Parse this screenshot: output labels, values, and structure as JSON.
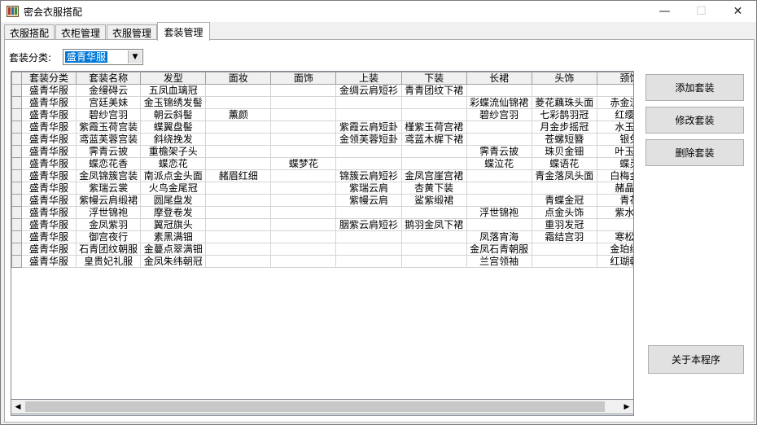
{
  "window": {
    "title": "密会衣服搭配",
    "minimize": "—",
    "maximize": "☐",
    "close": "✕"
  },
  "tabs": [
    "衣服搭配",
    "衣柜管理",
    "衣服管理",
    "套装管理"
  ],
  "active_tab": 3,
  "filter": {
    "label": "套装分类:",
    "value": "盛青华服"
  },
  "buttons": {
    "add": "添加套装",
    "edit": "修改套装",
    "delete": "删除套装",
    "about": "关于本程序"
  },
  "table": {
    "columns": [
      "套装分类",
      "套装名称",
      "发型",
      "面妆",
      "面饰",
      "上装",
      "下装",
      "长裙",
      "头饰",
      "颈饰"
    ],
    "rows": [
      [
        "盛青华服",
        "金缦碍云",
        "五凤血璃冠",
        "",
        "",
        "金绸云肩短衫",
        "青青团纹下裙",
        "",
        "",
        ""
      ],
      [
        "盛青华服",
        "宫廷美妹",
        "金玉锦绣发髻",
        "",
        "",
        "",
        "",
        "彩蝶流仙锦裙",
        "菱花藕珠头面",
        "赤金流苏"
      ],
      [
        "盛青华服",
        "碧纱宫羽",
        "朝云斜髻",
        "薰颜",
        "",
        "",
        "",
        "碧纱宫羽",
        "七彩鹊羽冠",
        "红缨流"
      ],
      [
        "盛青华服",
        "紫霞玉荷宫装",
        "蝶翼盘髻",
        "",
        "",
        "紫霞云肩短卦",
        "槿紫玉荷宫裙",
        "",
        "月金步摇冠",
        "水玉项"
      ],
      [
        "盛青华服",
        "鸢蓝芙蓉宫装",
        "斜绕挽发",
        "",
        "",
        "金领芙蓉短卦",
        "鸢蓝木樨下裙",
        "",
        "苍螺短簪",
        "银兔"
      ],
      [
        "盛青华服",
        "霁青云披",
        "重檐架子头",
        "",
        "",
        "",
        "",
        "霁青云披",
        "珠贝金钿",
        "叶玉项"
      ],
      [
        "盛青华服",
        "蝶恋花香",
        "蝶恋花",
        "",
        "蝶梦花",
        "",
        "",
        "蝶泣花",
        "蝶语花",
        "蝶灵"
      ],
      [
        "盛青华服",
        "金凤锦簇宫装",
        "南派点金头面",
        "赭眉红细",
        "",
        "锦簇云肩短衫",
        "金凤宫崖宫裙",
        "",
        "青金落凤头面",
        "白梅金项"
      ],
      [
        "盛青华服",
        "紫瑞云裳",
        "火鸟金尾冠",
        "",
        "",
        "紫瑞云肩",
        "杏黄下装",
        "",
        "",
        "赭晶宽"
      ],
      [
        "盛青华服",
        "紫幔云肩缎裙",
        "圆尾盘发",
        "",
        "",
        "紫幔云肩",
        "鲨紫缎裙",
        "",
        "青蝶金冠",
        "青花"
      ],
      [
        "盛青华服",
        "浮世锦袍",
        "摩登卷发",
        "",
        "",
        "",
        "",
        "浮世锦袍",
        "点金头饰",
        "紫水晶"
      ],
      [
        "盛青华服",
        "金凤紫羽",
        "翼冠旗头",
        "",
        "",
        "胭紫云肩短衫",
        "鹅羽金凤下裙",
        "",
        "重羽发冠",
        ""
      ],
      [
        "盛青华服",
        "御宫夜行",
        "素黑满钿",
        "",
        "",
        "",
        "",
        "凤落宵海",
        "霜结宫羽",
        "寒松白"
      ],
      [
        "盛青华服",
        "石青团纹朝服",
        "金蔓点翠满钿",
        "",
        "",
        "",
        "",
        "金凤石青朝服",
        "",
        "金珀绿松"
      ],
      [
        "盛青华服",
        "皇贵妃礼服",
        "金凤朱纬朝冠",
        "",
        "",
        "",
        "",
        "兰宫领袖",
        "",
        "红瑚朝珠"
      ]
    ]
  }
}
